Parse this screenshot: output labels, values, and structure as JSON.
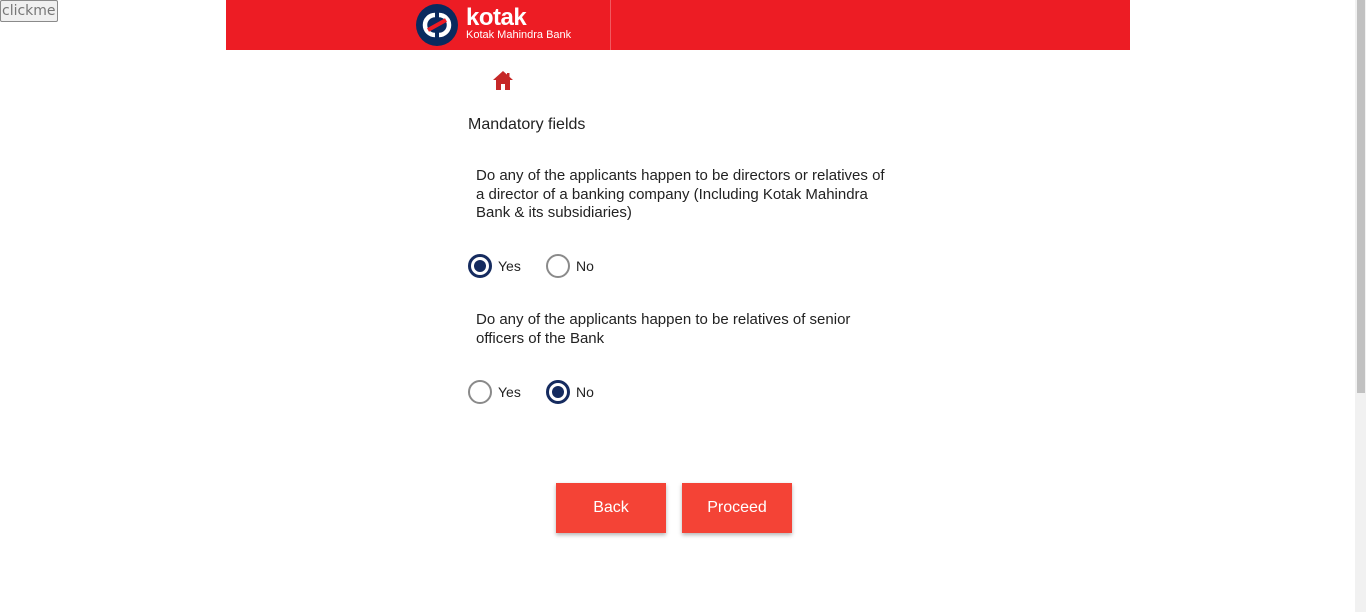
{
  "clickme_label": "clickme",
  "brand": {
    "name": "kotak",
    "subtitle": "Kotak Mahindra Bank",
    "header_color": "#ed1c24",
    "logo_circle_color": "#0a2a5e"
  },
  "form": {
    "mandatory_label": "Mandatory fields",
    "questions": [
      {
        "text": "Do any of the applicants happen to be directors or relatives of a director of a banking company (Including Kotak Mahindra Bank & its subsidiaries)",
        "options": [
          "Yes",
          "No"
        ],
        "selected": "Yes"
      },
      {
        "text": "Do any of the applicants happen to be relatives of senior officers of the Bank",
        "options": [
          "Yes",
          "No"
        ],
        "selected": "No"
      }
    ]
  },
  "buttons": {
    "back_label": "Back",
    "proceed_label": "Proceed",
    "color": "#f44336"
  },
  "icons": {
    "home": "home-icon"
  },
  "accent_radio_color": "#152b5f"
}
